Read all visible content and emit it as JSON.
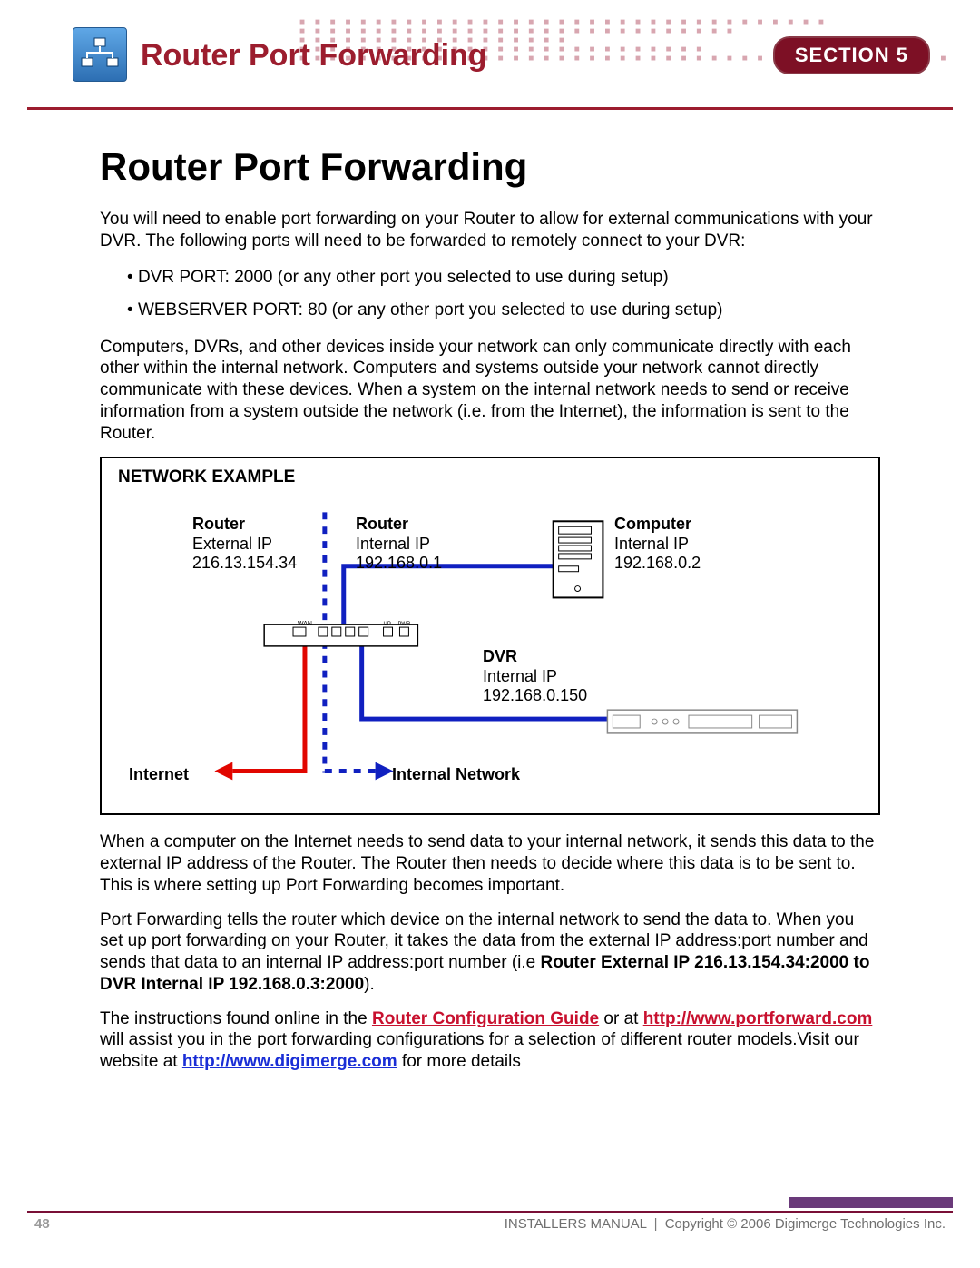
{
  "header": {
    "title": "Router Port Forwarding",
    "section_label": "SECTION 5"
  },
  "page": {
    "title": "Router Port Forwarding",
    "intro": "You will need to enable port forwarding on your Router to allow for external communications with your DVR. The following ports will need to be forwarded to remotely connect to your DVR:",
    "bullet1": "DVR PORT: 2000 (or any other port you selected to use during setup)",
    "bullet2": "WEBSERVER PORT: 80 (or any other port you selected to use during setup)",
    "para2": "Computers, DVRs, and other devices inside your network can only communicate directly with each other within the internal network. Computers and systems outside your network cannot directly communicate with these devices. When a system on the internal network needs to send or receive information from a system outside the network (i.e. from the Internet), the information is sent to the Router.",
    "diagram": {
      "title": "NETWORK EXAMPLE",
      "router_ext": {
        "h": "Router",
        "l1": "External IP",
        "l2": "216.13.154.34"
      },
      "router_int": {
        "h": "Router",
        "l1": "Internal IP",
        "l2": "192.168.0.1"
      },
      "computer": {
        "h": "Computer",
        "l1": "Internal IP",
        "l2": "192.168.0.2"
      },
      "dvr": {
        "h": "DVR",
        "l1": "Internal IP",
        "l2": "192.168.0.150"
      },
      "internet": "Internet",
      "internal_network": "Internal Network"
    },
    "para3": "When a computer on the Internet needs to send data to your internal network, it sends this data to the external IP address of the Router. The Router then needs to decide where this data is to be sent to. This is where setting up Port Forwarding becomes important.",
    "para4a": "Port Forwarding tells the router which device on the internal network to send the data to. When you set up port forwarding on your Router, it takes the data from the external IP address:port number and sends that data to an internal IP address:port number (i.e ",
    "para4b": "Router External IP 216.13.154.34:2000 to DVR Internal IP 192.168.0.3:2000",
    "para4c": ").",
    "para5a": "The instructions found online in the ",
    "link1": "Router Configuration Guide",
    "para5b": " or at ",
    "link2": "http://www.portforward.com ",
    "para5c": "will assist you in the port forwarding configurations for a selection of different router models.Visit our website at ",
    "link3": "http://www.digimerge.com",
    "para5d": " for more details"
  },
  "footer": {
    "page_number": "48",
    "manual": "INSTALLERS MANUAL",
    "copyright": "Copyright © 2006 Digimerge Technologies Inc."
  }
}
